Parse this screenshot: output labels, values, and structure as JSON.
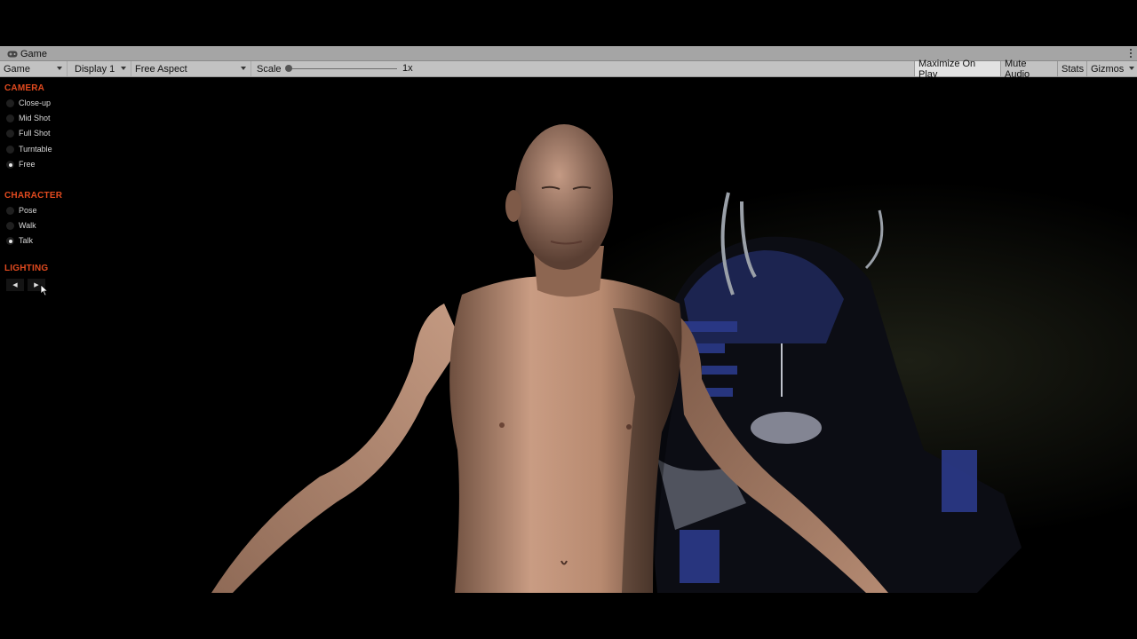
{
  "window": {
    "tab_title": "Game",
    "tab_icon": "gamepad-icon"
  },
  "toolbar": {
    "view_select": "Game",
    "display_select": "Display 1",
    "aspect_select": "Free Aspect",
    "scale_label": "Scale",
    "scale_value": "1x",
    "scale_level": 0.0,
    "maximize_on_play": "Maximize On Play",
    "maximize_on_play_active": true,
    "mute_audio": "Mute Audio",
    "stats": "Stats",
    "gizmos": "Gizmos"
  },
  "overlay": {
    "camera": {
      "title": "CAMERA",
      "options": [
        "Close-up",
        "Mid Shot",
        "Full Shot",
        "Turntable",
        "Free"
      ],
      "selected": "Free"
    },
    "character": {
      "title": "CHARACTER",
      "options": [
        "Pose",
        "Walk",
        "Talk"
      ],
      "selected": "Talk"
    },
    "lighting": {
      "title": "LIGHTING",
      "prev_icon": "arrow-left-icon",
      "next_icon": "arrow-right-icon"
    }
  },
  "colors": {
    "accent": "#e14a1f",
    "toolbar_bg": "#c2c2c2",
    "tab_bg": "#a5a5a5",
    "viewport_bg": "#000000"
  }
}
